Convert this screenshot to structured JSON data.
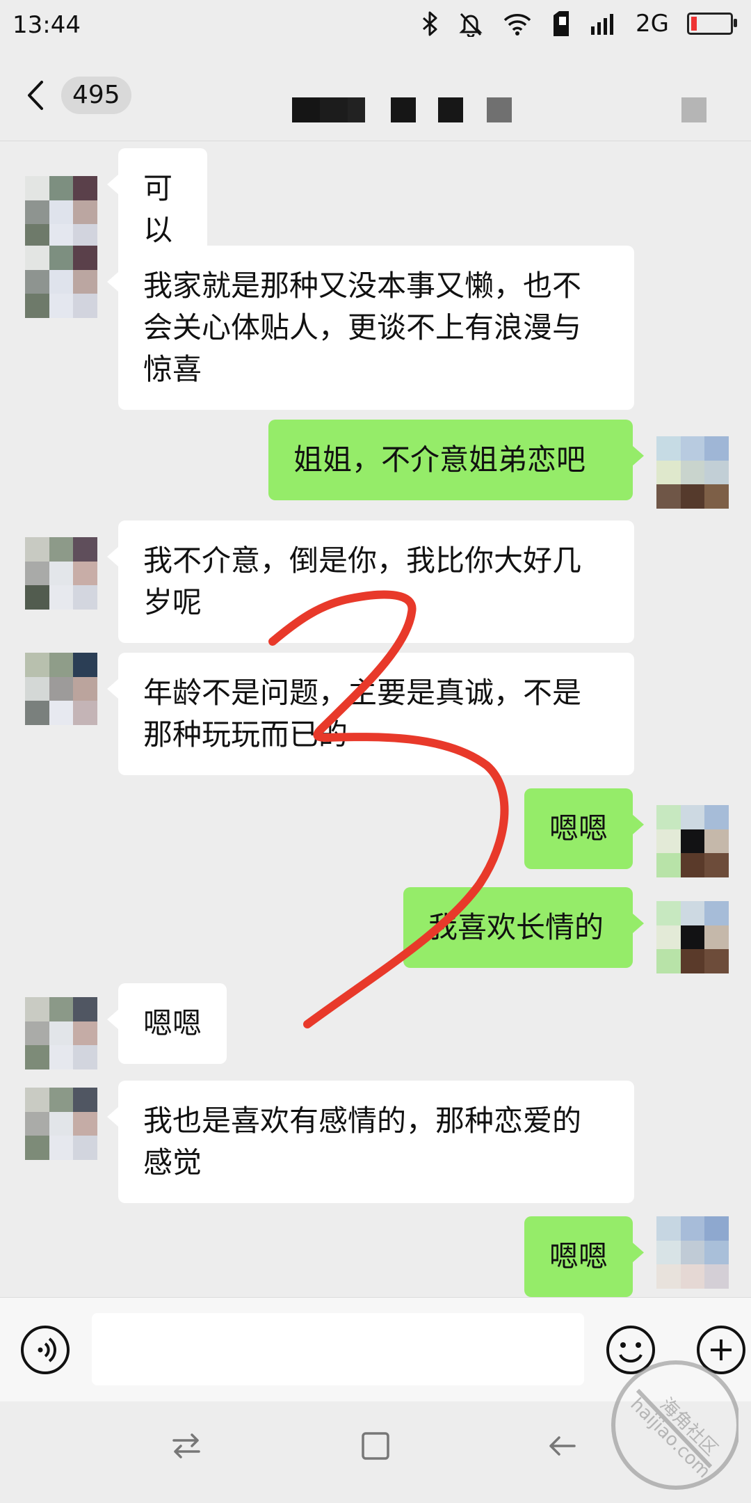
{
  "status_bar": {
    "time": "13:44",
    "network": "2G",
    "icons": [
      "bluetooth-icon",
      "mute-bell-icon",
      "wifi-icon",
      "sim-icon",
      "signal-icon",
      "battery-icon"
    ]
  },
  "header": {
    "back_icon": "chevron-left-icon",
    "unread_count": "495"
  },
  "messages": [
    {
      "side": "in",
      "text": "可以"
    },
    {
      "side": "in",
      "text": "我家就是那种又没本事又懒，也不会关心体贴人，更谈不上有浪漫与惊喜"
    },
    {
      "side": "out",
      "text": "姐姐，不介意姐弟恋吧"
    },
    {
      "side": "in",
      "text": "我不介意，倒是你，我比你大好几岁呢"
    },
    {
      "side": "in",
      "text": "年龄不是问题，主要是真诚，不是那种玩玩而已的"
    },
    {
      "side": "out",
      "text": "嗯嗯"
    },
    {
      "side": "out",
      "text": "我喜欢长情的"
    },
    {
      "side": "in",
      "text": "嗯嗯"
    },
    {
      "side": "in",
      "text": "我也是喜欢有感情的，那种恋爱的感觉"
    },
    {
      "side": "out",
      "text": "嗯嗯"
    }
  ],
  "input_bar": {
    "voice_icon": "voice-icon",
    "emoji_icon": "emoji-icon",
    "more_icon": "more-icon",
    "input_value": ""
  },
  "nav_bar": {
    "icons": [
      "switch-icon",
      "home-square-icon",
      "back-arrow-icon"
    ]
  },
  "watermark": {
    "domain": "haijiao.com",
    "name": "海角社区"
  },
  "colors": {
    "background": "#ededed",
    "incoming_bubble": "#ffffff",
    "outgoing_bubble": "#95ec69",
    "scribble": "#e8392a"
  }
}
